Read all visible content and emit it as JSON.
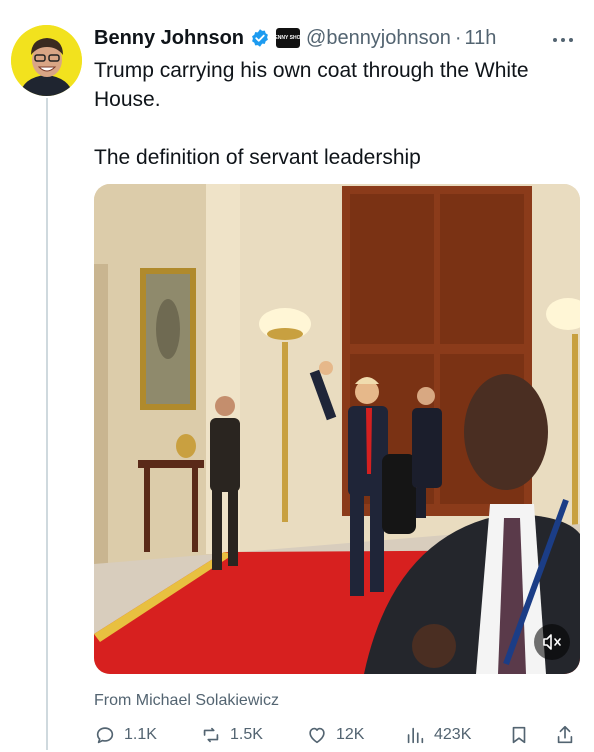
{
  "author": {
    "name": "Benny Johnson",
    "handle": "@bennyjohnson",
    "time": "11h",
    "affiliate_badge": "BENNY SHOW"
  },
  "tweet": {
    "line1": "Trump carrying his own coat through the White House.",
    "line2": "The definition of servant leadership"
  },
  "media": {
    "source": "From Michael Solakiewicz"
  },
  "actions": {
    "replies": "1.1K",
    "reposts": "1.5K",
    "likes": "12K",
    "views": "423K"
  },
  "colors": {
    "verified": "#1d9bf0",
    "muted_text": "#536471",
    "primary_text": "#0f1419"
  },
  "icons": [
    "more-icon",
    "verified-icon",
    "reply-icon",
    "repost-icon",
    "like-icon",
    "views-icon",
    "bookmark-icon",
    "share-icon",
    "mute-icon"
  ]
}
